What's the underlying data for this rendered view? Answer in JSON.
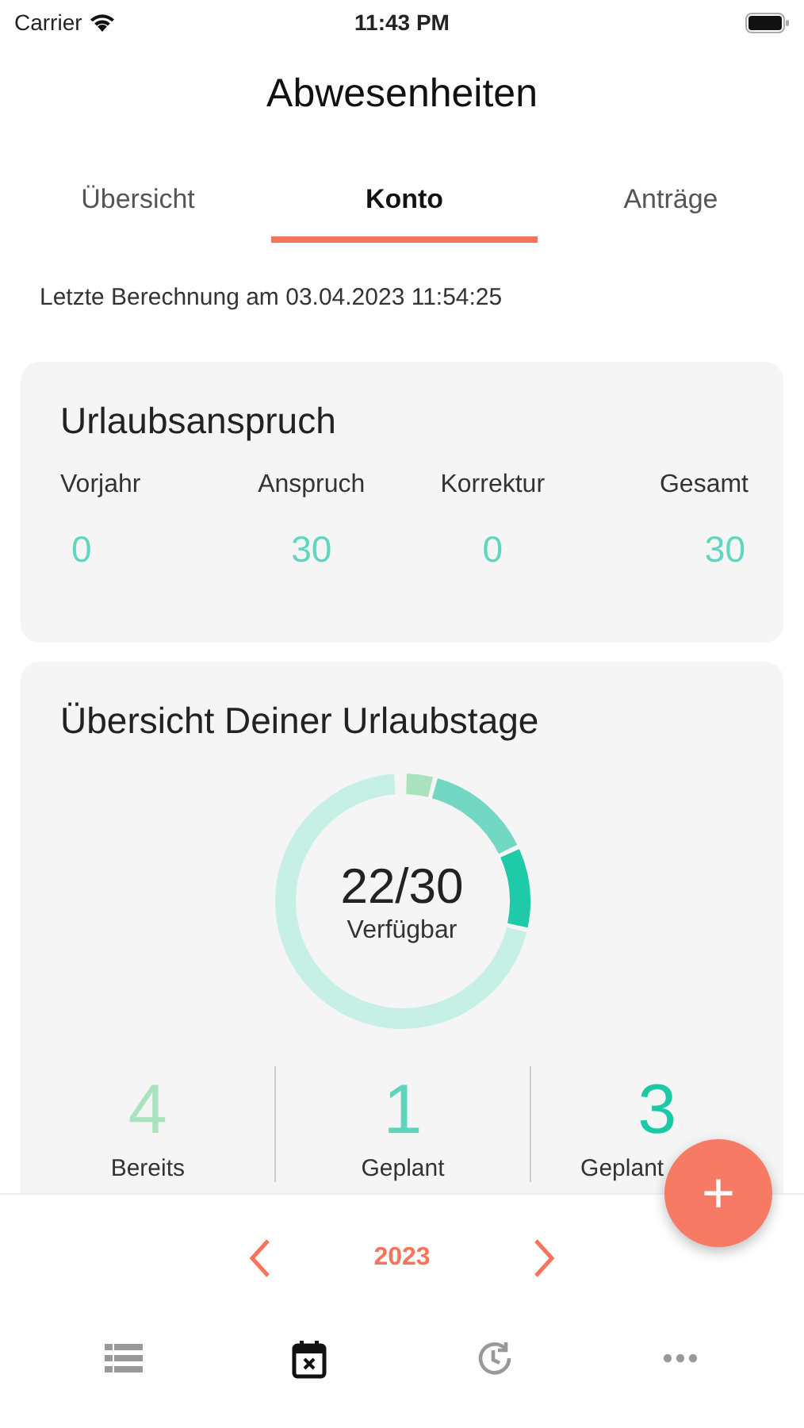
{
  "status_bar": {
    "carrier": "Carrier",
    "time": "11:43 PM"
  },
  "title": "Abwesenheiten",
  "tabs": [
    {
      "label": "Übersicht",
      "selected": false
    },
    {
      "label": "Konto",
      "selected": true
    },
    {
      "label": "Anträge",
      "selected": false
    }
  ],
  "last_calculation": "Letzte Berechnung am 03.04.2023 11:54:25",
  "entitlement_card": {
    "title": "Urlaubsanspruch",
    "columns": [
      {
        "label": "Vorjahr",
        "value": "0"
      },
      {
        "label": "Anspruch",
        "value": "30"
      },
      {
        "label": "Korrektur",
        "value": "0"
      },
      {
        "label": "Gesamt",
        "value": "30"
      }
    ]
  },
  "overview_card": {
    "title": "Übersicht Deiner Urlaubstage",
    "ring": {
      "value": "22/30",
      "caption": "Verfügbar"
    },
    "stats": [
      {
        "value": "4",
        "label": "Bereits",
        "color": "#a9e2bd"
      },
      {
        "value": "1",
        "label": "Geplant",
        "color": "#5fd4bd"
      },
      {
        "value": "3",
        "label": "Geplant",
        "color": "#1cc9a6"
      }
    ]
  },
  "add_button": "+",
  "year_nav": {
    "year": "2023"
  },
  "bottom_nav": [
    {
      "kind": "list",
      "selected": false
    },
    {
      "kind": "calendar",
      "selected": true
    },
    {
      "kind": "history",
      "selected": false
    },
    {
      "kind": "more",
      "selected": false
    }
  ]
}
